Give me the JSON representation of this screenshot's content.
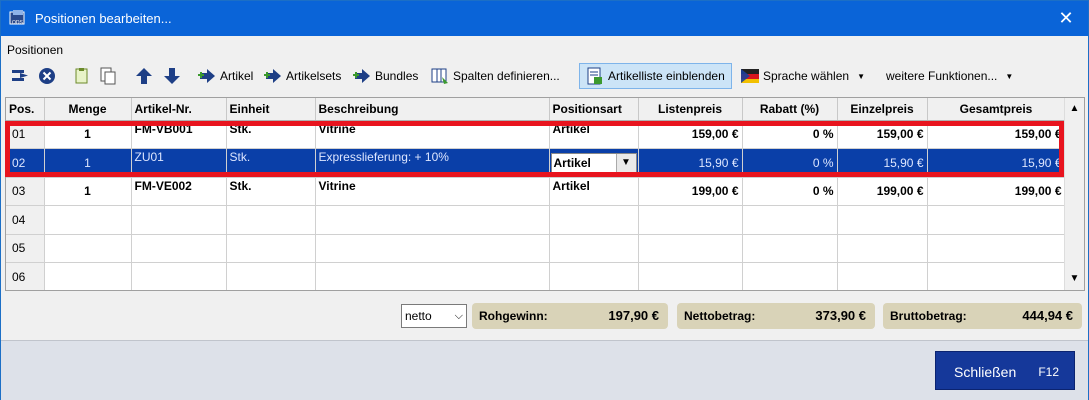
{
  "window": {
    "title": "Positionen bearbeiten...",
    "close_glyph": "✕"
  },
  "section_label": "Positionen",
  "toolbar": {
    "icons": [
      "insert-row-icon",
      "delete-icon",
      "copy-icon",
      "paste-icon",
      "move-up-icon",
      "move-down-icon"
    ],
    "artikel": "Artikel",
    "artikelsets": "Artikelsets",
    "bundles": "Bundles",
    "spalten": "Spalten definieren...",
    "artikelliste": "Artikelliste einblenden",
    "sprache": "Sprache wählen",
    "weitere": "weitere Funktionen..."
  },
  "grid": {
    "columns": [
      "Pos.",
      "Menge",
      "Artikel-Nr.",
      "Einheit",
      "Beschreibung",
      "Positionsart",
      "Listenpreis",
      "Rabatt (%)",
      "Einzelpreis",
      "Gesamtpreis"
    ],
    "rows": [
      {
        "pos": "01",
        "menge": "1",
        "artikel_nr": "FM-VB001",
        "einheit": "Stk.",
        "beschreibung": "Vitrine",
        "art": "Artikel",
        "listenpreis": "159,00 €",
        "rabatt": "0 %",
        "einzelpreis": "159,00 €",
        "gesamtpreis": "159,00 €"
      },
      {
        "pos": "02",
        "menge": "1",
        "artikel_nr": "ZU01",
        "einheit": "Stk.",
        "beschreibung": "Expresslieferung: + 10%",
        "art": "Artikel",
        "listenpreis": "15,90 €",
        "rabatt": "0 %",
        "einzelpreis": "15,90 €",
        "gesamtpreis": "15,90 €"
      },
      {
        "pos": "03",
        "menge": "1",
        "artikel_nr": "FM-VE002",
        "einheit": "Stk.",
        "beschreibung": "Vitrine",
        "art": "Artikel",
        "listenpreis": "199,00 €",
        "rabatt": "0 %",
        "einzelpreis": "199,00 €",
        "gesamtpreis": "199,00 €"
      },
      {
        "pos": "04"
      },
      {
        "pos": "05"
      },
      {
        "pos": "06"
      }
    ],
    "selected_row": "02"
  },
  "summary": {
    "netto_select": "netto",
    "rohgewinn_label": "Rohgewinn:",
    "rohgewinn_value": "197,90 €",
    "netto_label": "Nettobetrag:",
    "netto_value": "373,90 €",
    "brutto_label": "Bruttobetrag:",
    "brutto_value": "444,94 €"
  },
  "footer": {
    "close_label": "Schließen",
    "close_key": "F12"
  },
  "colors": {
    "titlebar": "#0a64d8",
    "selection": "#0a3fa8",
    "highlight_frame": "#e8141e",
    "summary_box": "#d9d3b8",
    "close_button": "#15389a"
  }
}
